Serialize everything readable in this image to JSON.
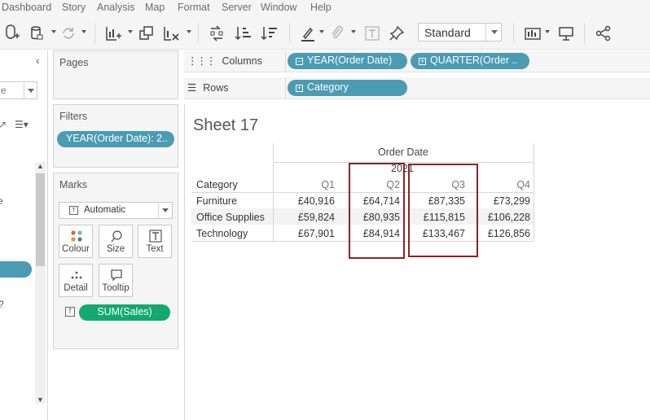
{
  "menu": [
    "Dashboard",
    "Story",
    "Analysis",
    "Map",
    "Format",
    "Server",
    "Window",
    "Help"
  ],
  "toolbar": {
    "fit": "Standard"
  },
  "left_pane": {
    "dropdown_value": "e",
    "text_fragment_1": "e",
    "text_fragment_2": "?"
  },
  "pages": {
    "title": "Pages"
  },
  "filters": {
    "title": "Filters",
    "pill": "YEAR(Order Date): 2.."
  },
  "marks": {
    "title": "Marks",
    "type": "Automatic",
    "buttons": [
      "Colour",
      "Size",
      "Text",
      "Detail",
      "Tooltip"
    ],
    "sum_pill": "SUM(Sales)"
  },
  "columns": {
    "label": "Columns",
    "pills": [
      "YEAR(Order Date)",
      "QUARTER(Order .."
    ]
  },
  "rows": {
    "label": "Rows",
    "pills": [
      "Category"
    ]
  },
  "sheet": {
    "title": "Sheet 17"
  },
  "crosstab": {
    "column_header": "Order Date",
    "year": "2021",
    "row_header": "Category",
    "quarters": [
      "Q1",
      "Q2",
      "Q3",
      "Q4"
    ],
    "rows": [
      {
        "category": "Furniture",
        "values": [
          "£40,916",
          "£64,714",
          "£87,335",
          "£73,299"
        ]
      },
      {
        "category": "Office Supplies",
        "values": [
          "£59,824",
          "£80,935",
          "£115,815",
          "£106,228"
        ]
      },
      {
        "category": "Technology",
        "values": [
          "£67,901",
          "£84,914",
          "£133,467",
          "£126,856"
        ]
      }
    ]
  },
  "colors": {
    "dimension_pill": "#4b9bb3",
    "measure_pill": "#12a870",
    "highlight": "#8b2424"
  },
  "icons": [
    "new-datasource-icon",
    "datasource-icon",
    "refresh-icon",
    "new-worksheet-icon",
    "duplicate-icon",
    "clear-sheet-icon",
    "swap-icon",
    "sort-ascending-icon",
    "sort-descending-icon",
    "highlight-icon",
    "annotate-icon",
    "label-icon",
    "pin-icon",
    "show-me-icon",
    "presentation-icon",
    "share-icon"
  ]
}
